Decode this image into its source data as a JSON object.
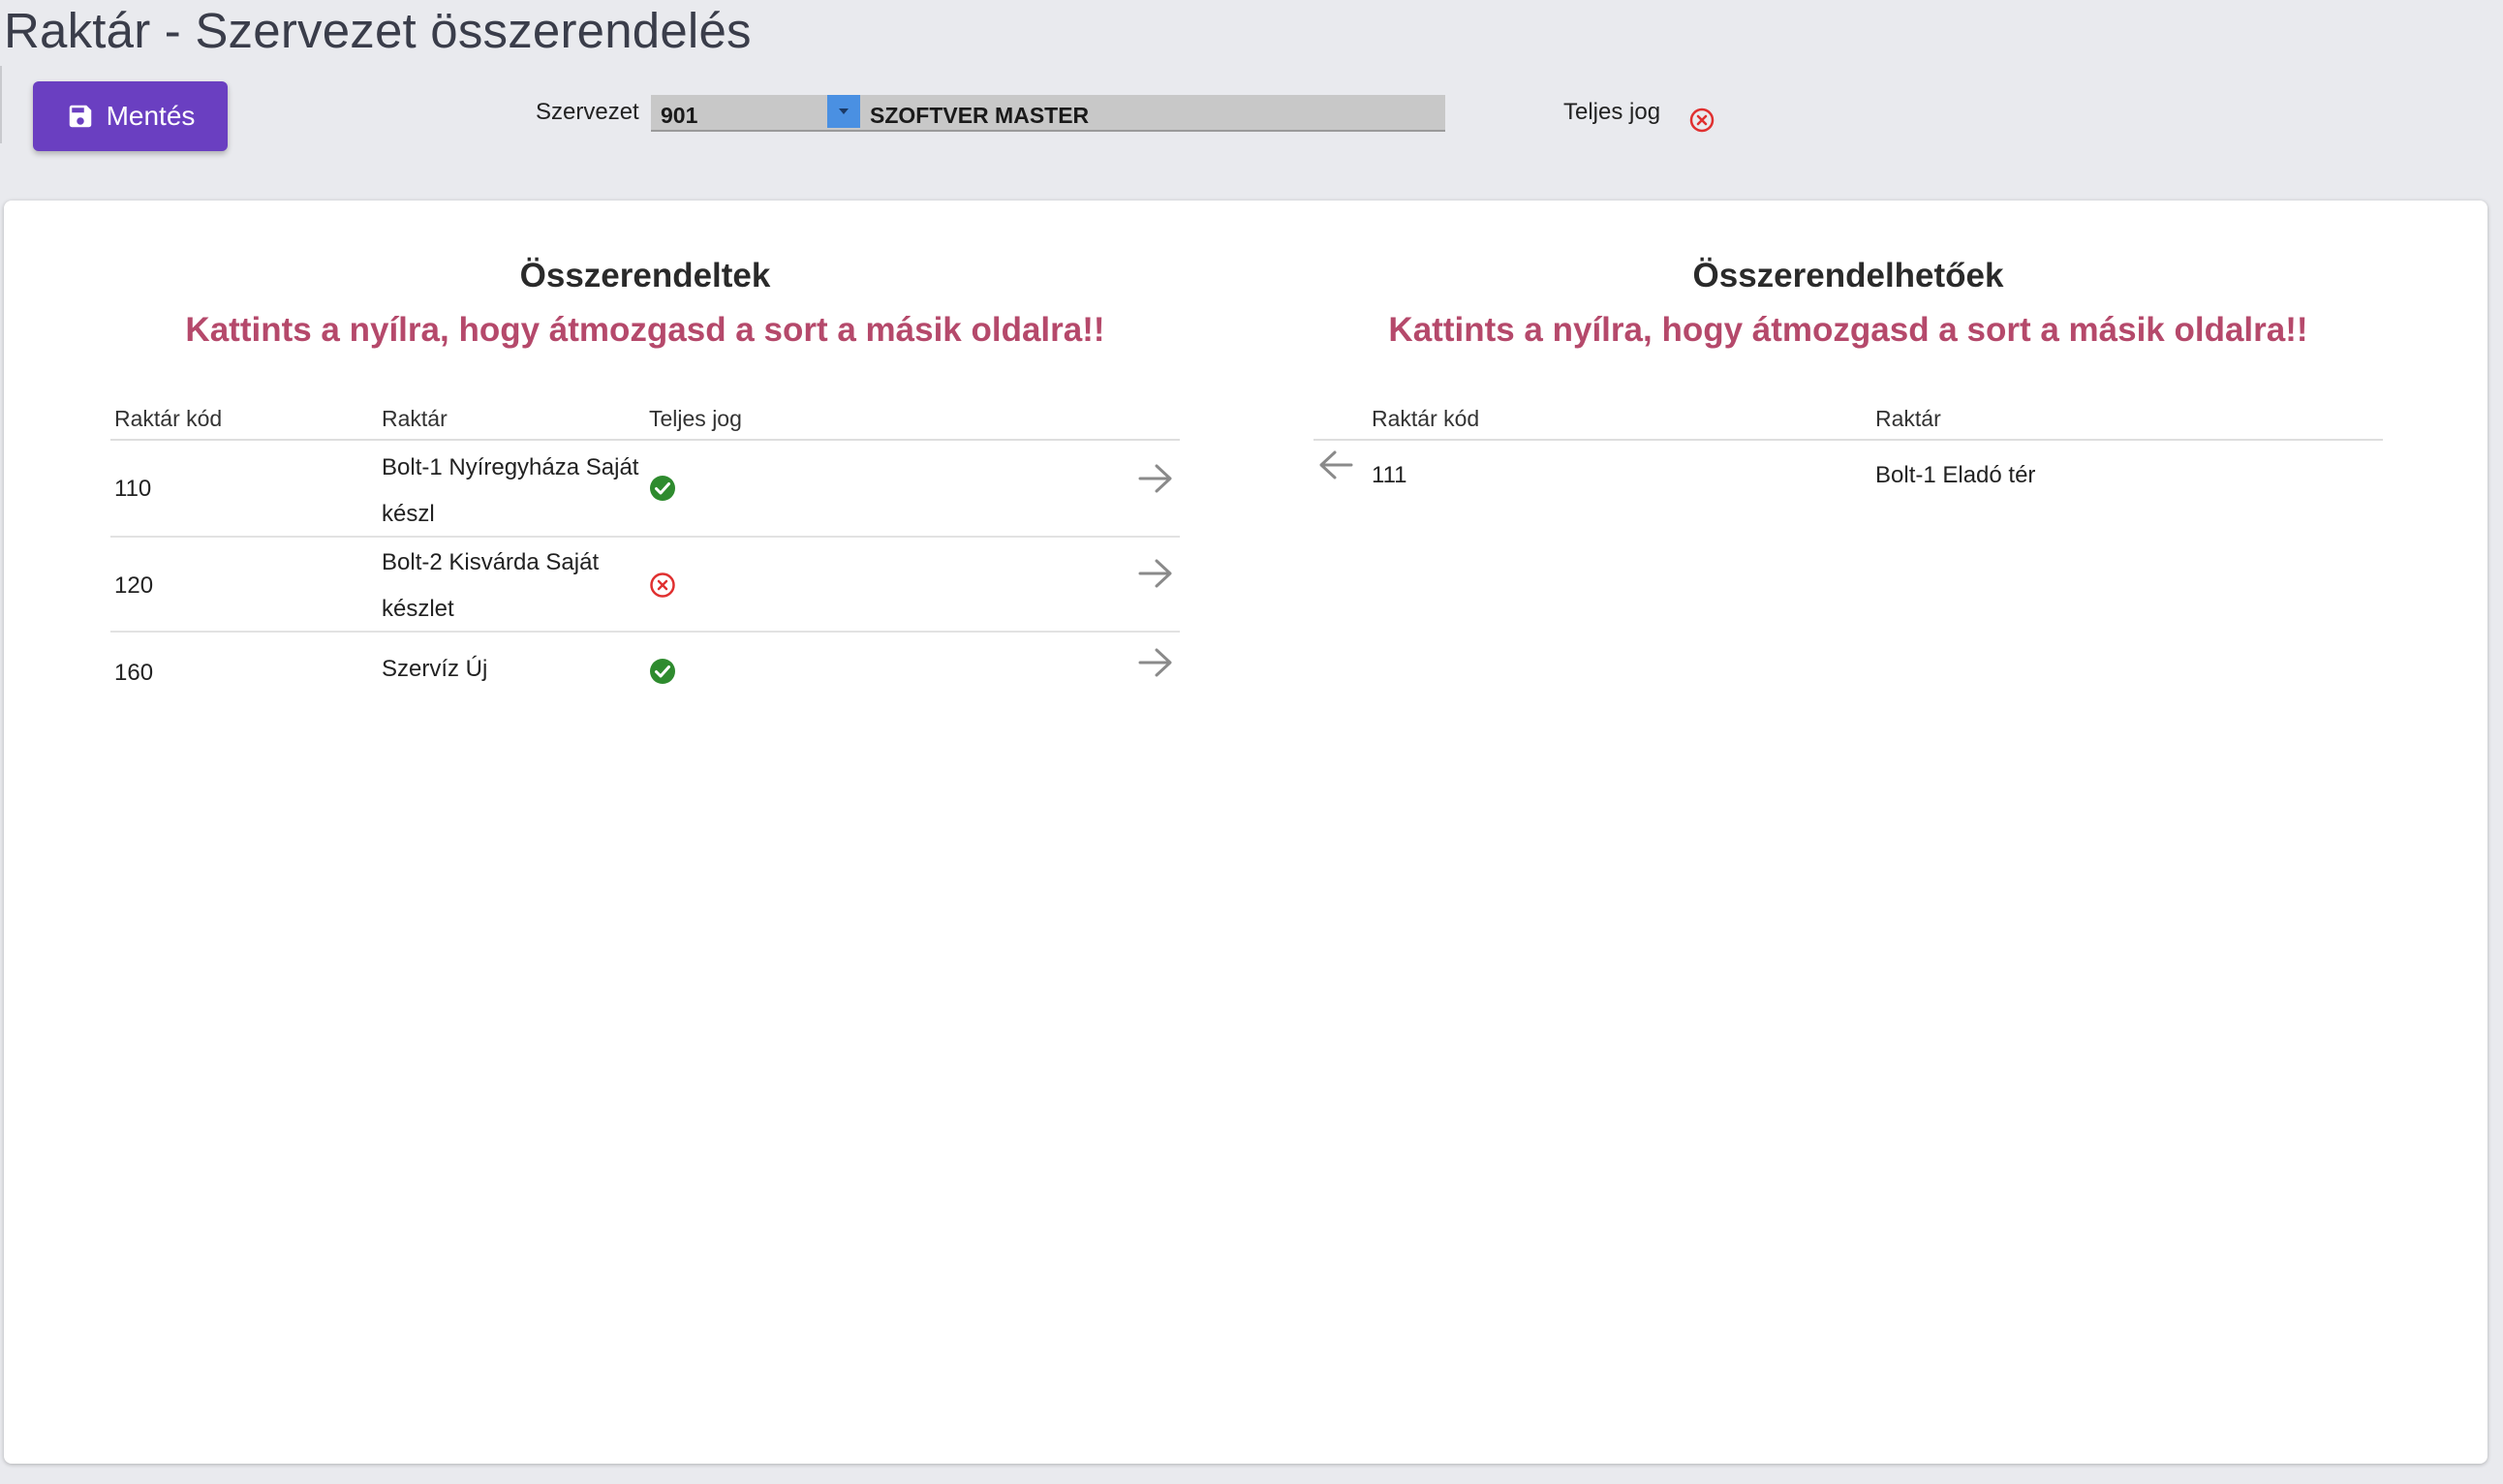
{
  "page": {
    "title": "Raktár - Szervezet összerendelés"
  },
  "toolbar": {
    "save_label": "Mentés",
    "org_label": "Szervezet",
    "org_code": "901",
    "org_name": "SZOFTVER MASTER",
    "full_right_label": "Teljes jog",
    "full_right_status": "denied"
  },
  "assigned": {
    "heading": "Összerendeltek",
    "hint": "Kattints a nyílra, hogy átmozgasd a sort a másik oldalra!!",
    "columns": [
      "Raktár kód",
      "Raktár",
      "Teljes jog"
    ],
    "rows": [
      {
        "code": "110",
        "name_line1": "Bolt-1 Nyíregyháza Saját",
        "name_line2": "készl",
        "full_right": "granted"
      },
      {
        "code": "120",
        "name_line1": "Bolt-2 Kisvárda Saját",
        "name_line2": "készlet",
        "full_right": "denied"
      },
      {
        "code": "160",
        "name_line1": "Szervíz Új",
        "name_line2": "",
        "full_right": "granted"
      }
    ]
  },
  "assignable": {
    "heading": "Összerendelhetőek",
    "hint": "Kattints a nyílra, hogy átmozgasd a sort a másik oldalra!!",
    "columns": [
      "Raktár kód",
      "Raktár"
    ],
    "rows": [
      {
        "code": "111",
        "name": "Bolt-1 Eladó tér"
      }
    ]
  },
  "colors": {
    "accent": "#6a3fc1",
    "hint": "#b5496b",
    "granted": "#2e8b2e",
    "denied": "#e03030",
    "dropdown": "#4a90e2"
  }
}
